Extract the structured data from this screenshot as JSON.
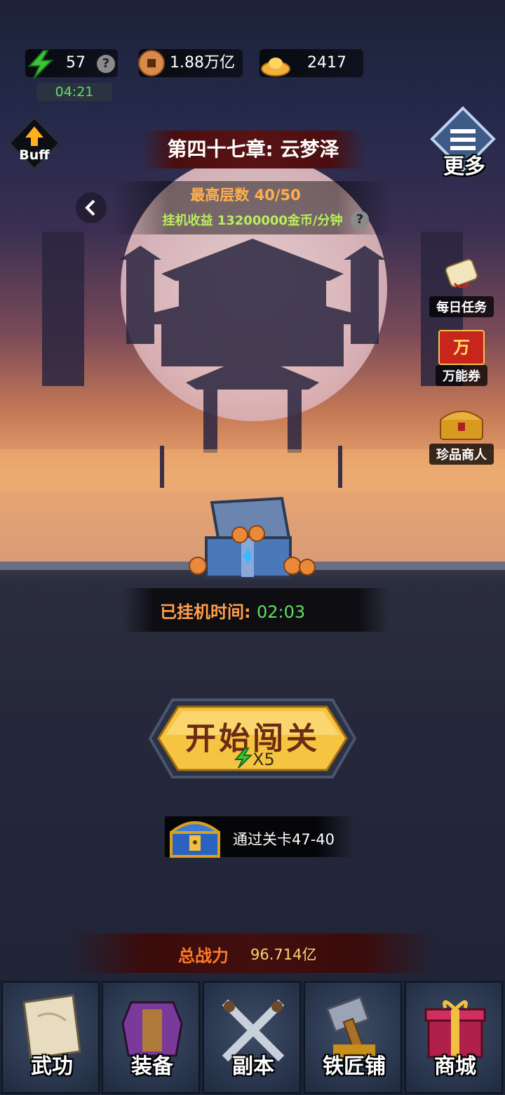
{
  "resources": {
    "energy": "57",
    "energy_timer": "04:21",
    "copper": "1.88万亿",
    "gold": "2417",
    "help_glyph": "?"
  },
  "buff_label": "Buff",
  "more_label": "更多",
  "chapter_title": "第四十七章: 云梦泽",
  "max_floor": "最高层数 40/50",
  "idle_income": "挂机收益 13200000金币/分钟",
  "side_buttons": [
    {
      "label": "每日任务",
      "icon": "scroll-icon"
    },
    {
      "label": "万能券",
      "icon": "voucher-icon"
    },
    {
      "label": "珍品商人",
      "icon": "treasure-chest-icon"
    }
  ],
  "voucher_glyph": "万",
  "idle_time_label": "已挂机时间:",
  "idle_time_value": "02:03",
  "start_button": {
    "label": "开始闯关",
    "cost": "X5"
  },
  "reward_text": "通过关卡47-40",
  "total_power_label": "总战力",
  "total_power_value": "96.714亿",
  "tabs": [
    {
      "label": "武功",
      "icon": "scroll-book-icon"
    },
    {
      "label": "装备",
      "icon": "armor-icon"
    },
    {
      "label": "副本",
      "icon": "crossed-swords-icon"
    },
    {
      "label": "铁匠铺",
      "icon": "hammer-icon"
    },
    {
      "label": "商城",
      "icon": "gift-box-icon"
    }
  ],
  "colors": {
    "energy_green": "#5fe060",
    "chapter_red": "#5a1214",
    "orange_text": "#ffb04a",
    "button_gold": "#f5c542"
  }
}
